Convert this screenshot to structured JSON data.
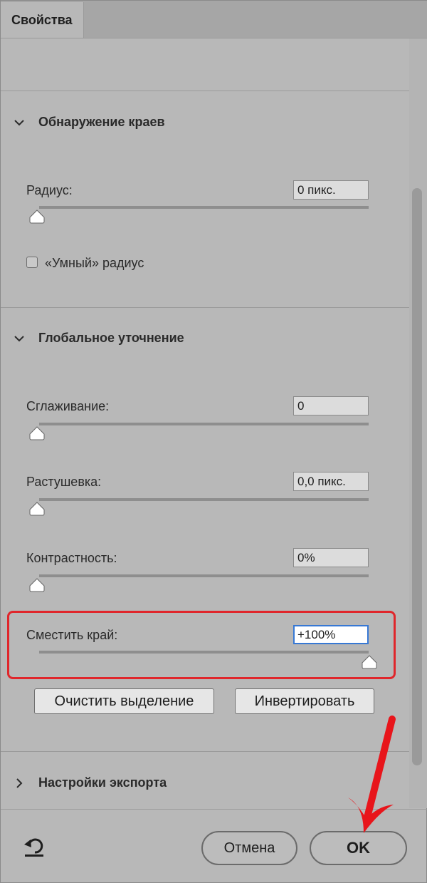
{
  "panel": {
    "tab_label": "Свойства"
  },
  "edge_detection": {
    "title": "Обнаружение краев",
    "radius_label": "Радиус:",
    "radius_value": "0 пикс.",
    "radius_level": 0,
    "smart_radius_label": "«Умный» радиус",
    "smart_radius_checked": false
  },
  "global_refinements": {
    "title": "Глобальное уточнение",
    "smooth_label": "Сглаживание:",
    "smooth_value": "0",
    "feather_label": "Растушевка:",
    "feather_value": "0,0 пикс.",
    "contrast_label": "Контрастность:",
    "contrast_value": "0%",
    "shift_edge_label": "Сместить край:",
    "shift_edge_value": "+100%",
    "shift_edge_level": 1.0,
    "clear_selection_label": "Очистить выделение",
    "invert_label": "Инвертировать"
  },
  "export_settings": {
    "title": "Настройки экспорта"
  },
  "footer": {
    "cancel_label": "Отмена",
    "ok_label": "OK"
  },
  "colors": {
    "highlight": "#e0262b",
    "active_field_border": "#3778d4"
  },
  "icons": {
    "section_expanded": "chevron-down-icon",
    "section_collapsed": "chevron-right-icon",
    "reset": "reset-icon",
    "slider_thumb": "slider-thumb-icon",
    "annotation": "red-arrow-icon"
  }
}
